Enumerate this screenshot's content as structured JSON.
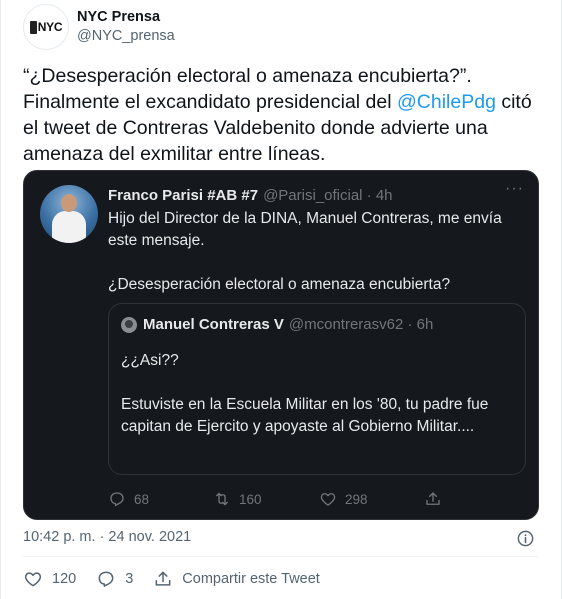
{
  "author": {
    "display_name": "NYC Prensa",
    "handle": "@NYC_prensa",
    "avatar_text": "NYC"
  },
  "tweet": {
    "text_before_mention": "“¿Desesperación electoral o amenaza encubierta?”. Finalmente el excandidato presidencial del ",
    "mention": "@ChilePdg",
    "text_after_mention": " citó el tweet de Contreras Valdebenito donde advierte una amenaza del exmilitar entre líneas.",
    "timestamp": "10:42 p. m. · 24 nov. 2021"
  },
  "embedded": {
    "name": "Franco Parisi #AB #7",
    "handle_time": "@Parisi_oficial · 4h",
    "more": "···",
    "text": "Hijo del Director de la DINA, Manuel Contreras, me envía este mensaje.\n\n¿Desesperación electoral o amenaza encubierta?",
    "quote": {
      "name": "Manuel Contreras V",
      "handle_time": "@mcontrerasv62 · 6h",
      "text": "¿¿Asi??\n\nEstuviste en la Escuela Militar en los '80, tu padre fue capitan de Ejercito y apoyaste al Gobierno Militar...."
    },
    "actions": {
      "replies": "68",
      "retweets": "160",
      "likes": "298"
    }
  },
  "footer_actions": {
    "likes": "120",
    "replies": "3",
    "share_label": "Compartir este Tweet"
  },
  "colors": {
    "accent": "#1d9bf0",
    "embed_bg": "#15181c",
    "muted": "#536471"
  },
  "icons": [
    "info-icon",
    "heart-icon",
    "reply-icon",
    "share-icon",
    "retweet-icon",
    "more-icon"
  ]
}
